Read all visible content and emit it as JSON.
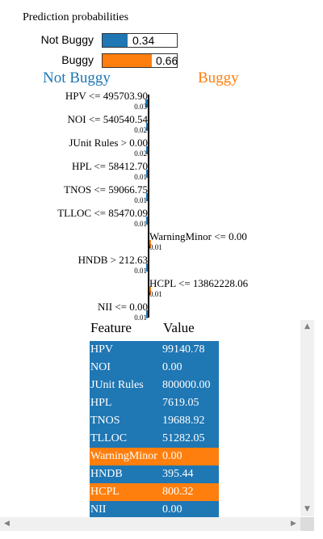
{
  "prediction": {
    "title": "Prediction probabilities",
    "items": [
      {
        "label": "Not Buggy",
        "value": 0.34,
        "display": "0.34",
        "color": "#1f77b4"
      },
      {
        "label": "Buggy",
        "value": 0.66,
        "display": "0.66",
        "color": "#ff7f0e"
      }
    ]
  },
  "explanation": {
    "negative_class": "Not Buggy",
    "positive_class": "Buggy",
    "negative_color": "#1f77b4",
    "positive_color": "#ff7f0e"
  },
  "chart_data": {
    "type": "bar",
    "categories": [
      "HPV <= 495703.90",
      "NOI <= 540540.54",
      "JUnit Rules > 0.00",
      "HPL <= 58412.70",
      "TNOS <= 59066.75",
      "TLLOC <= 85470.09",
      "WarningMinor <= 0.00",
      "HNDB > 212.63",
      "HCPL <= 13862228.06",
      "NII <= 0.00"
    ],
    "values": [
      -0.03,
      -0.02,
      -0.02,
      -0.01,
      -0.01,
      -0.01,
      0.01,
      -0.01,
      0.01,
      -0.01
    ],
    "value_labels": [
      "0.03",
      "0.02",
      "0.02",
      "0.01",
      "0.01",
      "0.01",
      "0.01",
      "0.01",
      "0.01",
      "0.01"
    ]
  },
  "table": {
    "headers": [
      "Feature",
      "Value"
    ],
    "rows": [
      {
        "feature": "HPV",
        "value": "99140.78",
        "highlight": false
      },
      {
        "feature": "NOI",
        "value": "0.00",
        "highlight": false
      },
      {
        "feature": "JUnit Rules",
        "value": "800000.00",
        "highlight": false
      },
      {
        "feature": "HPL",
        "value": "7619.05",
        "highlight": false
      },
      {
        "feature": "TNOS",
        "value": "19688.92",
        "highlight": false
      },
      {
        "feature": "TLLOC",
        "value": "51282.05",
        "highlight": false
      },
      {
        "feature": "WarningMinor",
        "value": "0.00",
        "highlight": true
      },
      {
        "feature": "HNDB",
        "value": "395.44",
        "highlight": false
      },
      {
        "feature": "HCPL",
        "value": "800.32",
        "highlight": true
      },
      {
        "feature": "NII",
        "value": "0.00",
        "highlight": false
      }
    ]
  },
  "scrollbars": {
    "up_icon": "arrow-up-icon",
    "down_icon": "arrow-down-icon",
    "left_icon": "arrow-left-icon",
    "right_icon": "arrow-right-icon"
  }
}
